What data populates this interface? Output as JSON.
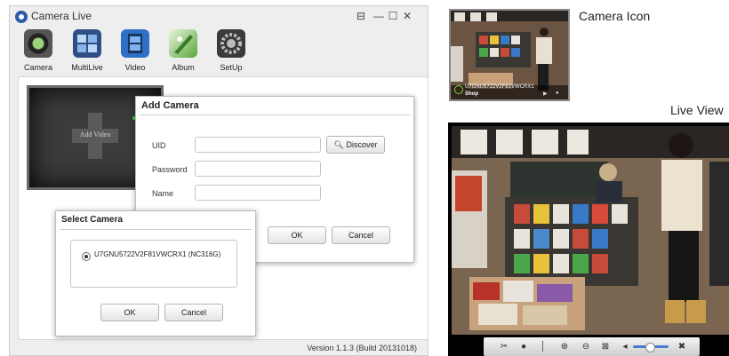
{
  "app": {
    "title": "Camera Live",
    "window_controls": [
      "⊟",
      "—",
      "☐",
      "✕"
    ],
    "toolbar": [
      {
        "label": "Camera",
        "icon": "camera-icon",
        "color": "#2b2b2b"
      },
      {
        "label": "MultiLive",
        "icon": "multilive-icon",
        "color": "#3c6fb6"
      },
      {
        "label": "Video",
        "icon": "video-icon",
        "color": "#3f7fd0"
      },
      {
        "label": "Album",
        "icon": "album-icon",
        "color": "#5aa63c"
      },
      {
        "label": "SetUp",
        "icon": "setup-icon",
        "color": "#4a4a4a"
      }
    ],
    "camera_tile_label": "Add Video",
    "version": "Version 1.1.3 (Build 20131018)"
  },
  "add_camera_dialog": {
    "title": "Add Camera",
    "uid_label": "UID",
    "uid_value": "",
    "discover_label": "Discover",
    "password_label": "Password",
    "password_value": "",
    "name_label": "Name",
    "name_value": "",
    "ok_label": "OK",
    "cancel_label": "Cancel"
  },
  "select_camera_dialog": {
    "title": "Select Camera",
    "option": "U7GNU5722V2F81VWCRX1  (NC316G)",
    "ok_label": "OK",
    "cancel_label": "Cancel"
  },
  "thumbnail": {
    "caption": "Camera Icon",
    "uid": "U7GNU5722V2F81VWCRX1",
    "location": "Shop"
  },
  "live_view": {
    "caption": "Live View",
    "controls": [
      "scissors-icon",
      "record-icon",
      "mic-icon",
      "zoom-in-icon",
      "zoom-out-icon",
      "fit-icon",
      "volume-icon",
      "volume-slider",
      "close-icon"
    ]
  }
}
